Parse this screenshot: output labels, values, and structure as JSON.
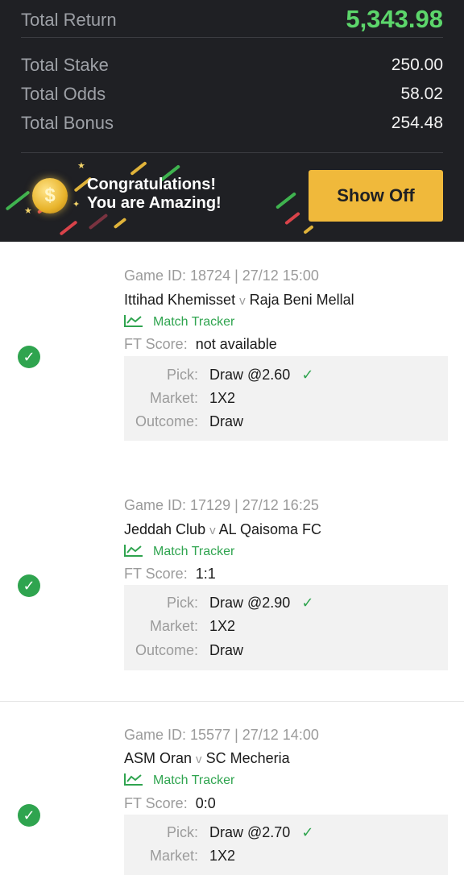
{
  "summary": {
    "total_return_label": "Total Return",
    "total_return_value": "5,343.98",
    "total_stake_label": "Total Stake",
    "total_stake_value": "250.00",
    "total_odds_label": "Total Odds",
    "total_odds_value": "58.02",
    "total_bonus_label": "Total Bonus",
    "total_bonus_value": "254.48"
  },
  "banner": {
    "line1": "Congratulations!",
    "line2": "You are Amazing!",
    "coin_symbol": "$",
    "button_label": "Show Off"
  },
  "labels": {
    "vs": "v",
    "match_tracker": "Match Tracker",
    "ft_score": "FT Score:",
    "pick": "Pick:",
    "market": "Market:",
    "outcome": "Outcome:"
  },
  "tickets": [
    {
      "game_id": "Game ID: 18724 | 27/12 15:00",
      "home": "Ittihad Khemisset",
      "away": "Raja Beni Mellal",
      "ft_score": "not available",
      "pick": "Draw @2.60",
      "market": "1X2",
      "outcome": "Draw"
    },
    {
      "game_id": "Game ID: 17129 | 27/12 16:25",
      "home": "Jeddah Club",
      "away": "AL Qaisoma FC",
      "ft_score": "1:1",
      "pick": "Draw @2.90",
      "market": "1X2",
      "outcome": "Draw"
    },
    {
      "game_id": "Game ID: 15577 | 27/12 14:00",
      "home": "ASM Oran",
      "away": "SC Mecheria",
      "ft_score": "0:0",
      "pick": "Draw @2.70",
      "market": "1X2"
    }
  ],
  "colors": {
    "summary_bg": "#1f2024",
    "return_green": "#5cd66b",
    "accent_gold": "#f0b93b",
    "success_green": "#2fa44f"
  },
  "icons": {
    "status": "check-circle-icon",
    "tracker": "line-chart-icon",
    "pick_result": "checkmark-icon",
    "coin": "dollar-coin-icon"
  }
}
